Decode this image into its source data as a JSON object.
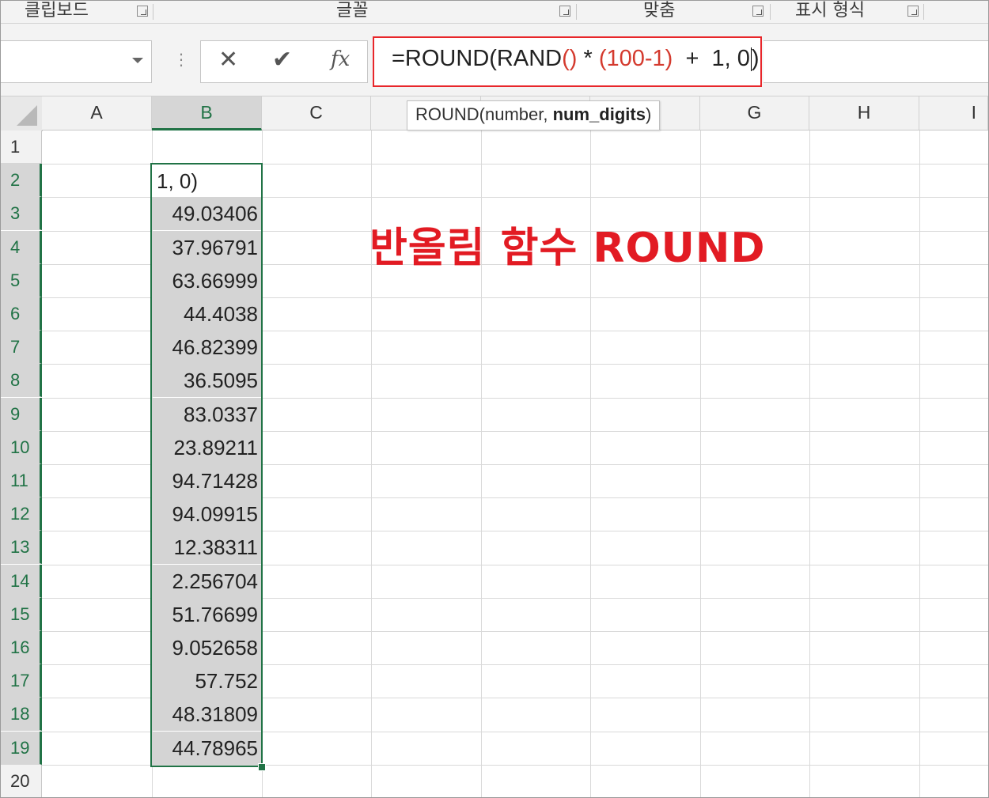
{
  "ribbon": {
    "groups": [
      {
        "label": "클립보드"
      },
      {
        "label": "글꼴"
      },
      {
        "label": "맞춤"
      },
      {
        "label": "표시 형식"
      }
    ]
  },
  "formula_bar": {
    "name_box": "",
    "cancel_icon": "✕",
    "enter_icon": "✔",
    "fx_label": "fx",
    "formula_pre": "=ROUND(RAND",
    "formula_paren": "()",
    "formula_mid": " * ",
    "formula_group": "(100-1)",
    "formula_post": "  +  1, 0",
    "formula_close": ")"
  },
  "tooltip": {
    "prefix": "ROUND(number, ",
    "bold": "num_digits",
    "suffix": ")"
  },
  "columns": [
    "A",
    "B",
    "C",
    "",
    "",
    "",
    "G",
    "H",
    "I"
  ],
  "rows": [
    "1",
    "2",
    "3",
    "4",
    "5",
    "6",
    "7",
    "8",
    "9",
    "10",
    "11",
    "12",
    "13",
    "14",
    "15",
    "16",
    "17",
    "18",
    "19",
    "20"
  ],
  "sheet": {
    "editing_cell_text": "1, 0)",
    "column_b_values": [
      "49.03406",
      "37.96791",
      "63.66999",
      "44.4038",
      "46.82399",
      "36.5095",
      "83.0337",
      "23.89211",
      "94.71428",
      "94.09915",
      "12.38311",
      "2.256704",
      "51.76699",
      "9.052658",
      "57.752",
      "48.31809",
      "44.78965"
    ]
  },
  "annotation": {
    "title": "반올림 함수 ROUND",
    "color": "#e21b23"
  },
  "colors": {
    "selection": "#217346",
    "highlight_box": "#e8262a"
  }
}
